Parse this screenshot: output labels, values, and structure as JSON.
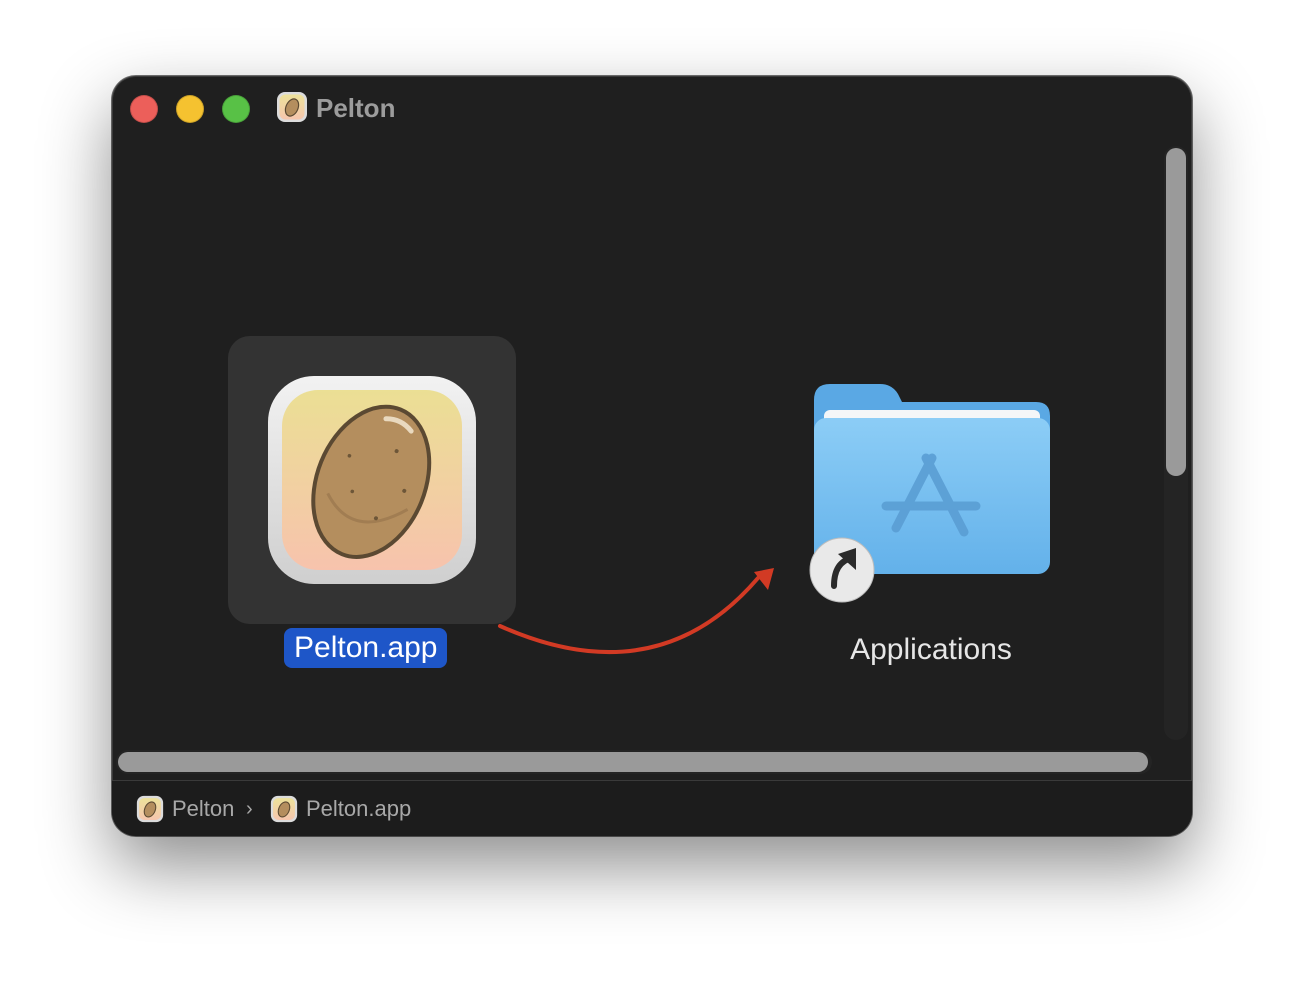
{
  "window": {
    "title": "Pelton"
  },
  "content": {
    "app_item": {
      "label": "Pelton.app"
    },
    "folder_item": {
      "label": "Applications"
    }
  },
  "pathbar": {
    "items": [
      {
        "label": "Pelton",
        "icon": "pelton-app-icon"
      },
      {
        "label": "Pelton.app",
        "icon": "pelton-app-icon"
      }
    ],
    "separator": "›"
  },
  "icons": {
    "title": "pelton-app-icon",
    "app": "potato-app-icon",
    "folder": "applications-folder-icon",
    "alias_badge": "alias-arrow-icon",
    "drag_hint": "curved-arrow-icon"
  },
  "colors": {
    "window_bg": "#1f1f1f",
    "selection": "#1e56c8",
    "close": "#ec5f5a",
    "minimize": "#f5c230",
    "maximize": "#58c146",
    "arrow": "#d23a24",
    "folder": "#74bff2"
  }
}
